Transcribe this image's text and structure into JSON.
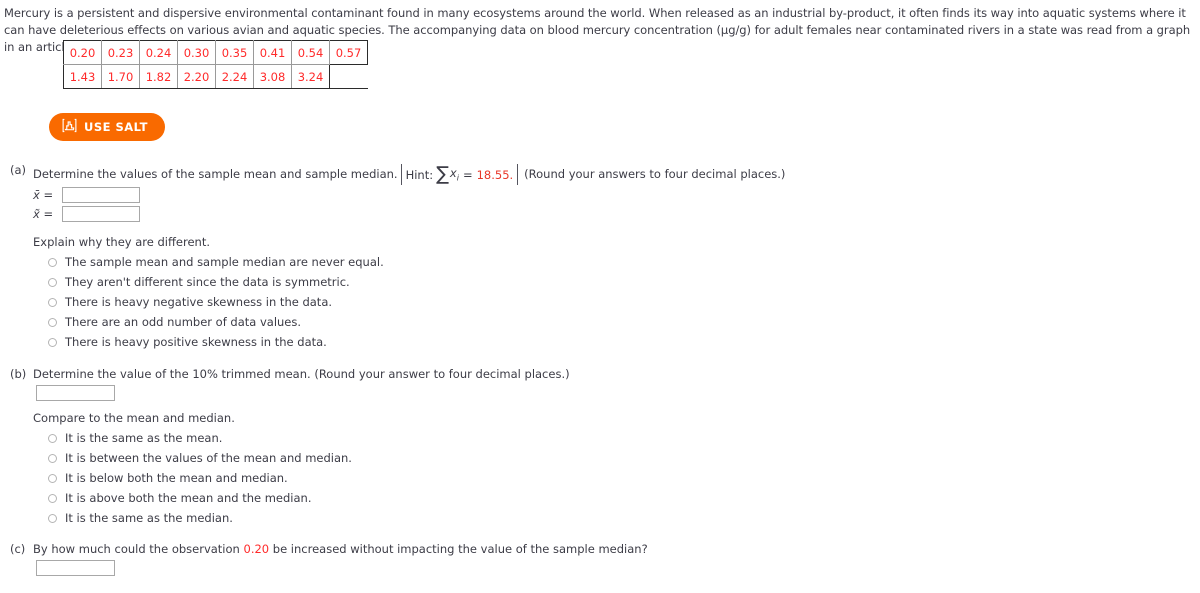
{
  "intro": {
    "paragraph": "Mercury is a persistent and dispersive environmental contaminant found in many ecosystems around the world. When released as an industrial by-product, it often finds its way into aquatic systems where it can have deleterious effects on various avian and aquatic species. The accompanying data on blood mercury concentration (µg/g) for adult females near contaminated rivers in a state was read from a graph in an article."
  },
  "data_table": {
    "rows": [
      [
        "0.20",
        "0.23",
        "0.24",
        "0.30",
        "0.35",
        "0.41",
        "0.54",
        "0.57"
      ],
      [
        "1.43",
        "1.70",
        "1.82",
        "2.20",
        "2.24",
        "3.08",
        "3.24"
      ]
    ],
    "value_color": "#ff2b2b"
  },
  "salt_button": {
    "label": "USE SALT",
    "icon": "distribution-curve-icon",
    "background": "#f96a00",
    "text_color": "#ffffff"
  },
  "part_a": {
    "marker": "(a)",
    "prompt": "Determine the values of the sample mean and sample median.",
    "hint_prefix": "Hint:",
    "hint_symbol": "∑",
    "hint_variable": "x",
    "hint_subscript": "i",
    "hint_equals": "=",
    "hint_value": "18.55.",
    "rounding_note": "(Round your answers to four decimal places.)",
    "mean_label": "x̄",
    "mean_equals": "=",
    "mean_value": "",
    "median_label": "x̃",
    "median_equals": "=",
    "median_value": "",
    "explain_heading": "Explain why they are different.",
    "options": [
      "The sample mean and sample median are never equal.",
      "They aren't different since the data is symmetric.",
      "There is heavy negative skewness in the data.",
      "There are an odd number of data values.",
      "There is heavy positive skewness in the data."
    ]
  },
  "part_b": {
    "marker": "(b)",
    "prompt": "Determine the value of the 10% trimmed mean. (Round your answer to four decimal places.)",
    "answer_value": "",
    "compare_heading": "Compare to the mean and median.",
    "options": [
      "It is the same as the mean.",
      "It is between the values of the mean and median.",
      "It is below both the mean and median.",
      "It is above both the mean and the median.",
      "It is the same as the median."
    ]
  },
  "part_c": {
    "marker": "(c)",
    "prompt_before": "By how much could the observation",
    "highlight_value": "0.20",
    "prompt_after": "be increased without impacting the value of the sample median?",
    "answer_value": ""
  }
}
